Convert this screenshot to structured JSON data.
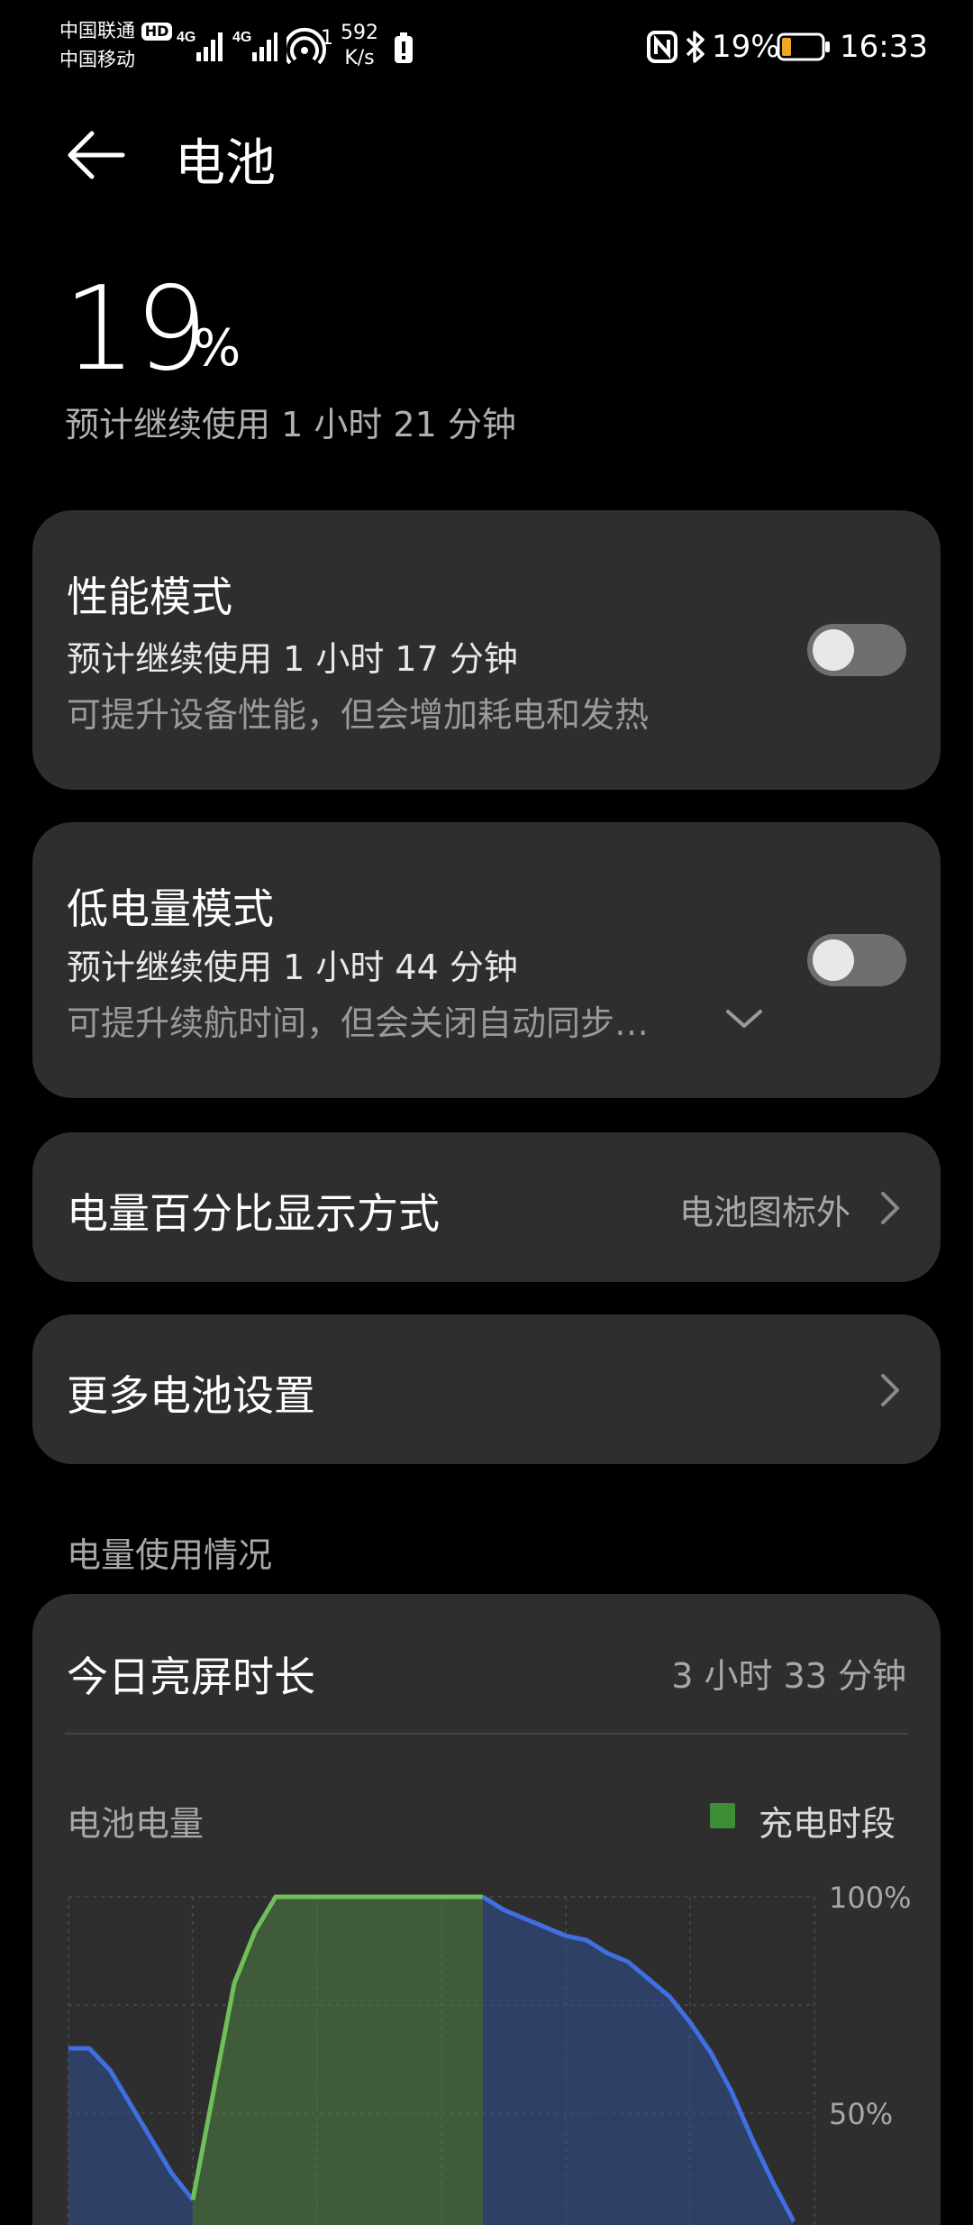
{
  "status_bar": {
    "carrier1": "中国联通",
    "hd_badge": "HD",
    "carrier2": "中国移动",
    "net1": "4G",
    "net2": "4G",
    "hotspot_count": "1",
    "speed_value": "592",
    "speed_unit": "K/s",
    "battery_pct": "19%",
    "time": "16:33",
    "icons": [
      "signal-icon",
      "hotspot-icon",
      "alert-icon",
      "nfc-icon",
      "bluetooth-icon",
      "battery-icon"
    ]
  },
  "header": {
    "title": "电池",
    "back_icon": "arrow-left-icon"
  },
  "hero": {
    "percent": "19",
    "percent_sign": "%",
    "estimate": "预计继续使用 1 小时 21 分钟"
  },
  "performance_mode": {
    "title": "性能模式",
    "estimate": "预计继续使用 1 小时 17 分钟",
    "desc": "可提升设备性能，但会增加耗电和发热",
    "enabled": false
  },
  "low_power_mode": {
    "title": "低电量模式",
    "estimate": "预计继续使用 1 小时 44 分钟",
    "desc": "可提升续航时间，但会关闭自动同步…",
    "enabled": false
  },
  "percent_display": {
    "label": "电量百分比显示方式",
    "value": "电池图标外"
  },
  "more_settings": {
    "label": "更多电池设置"
  },
  "usage": {
    "section_label": "电量使用情况",
    "screen_time_label": "今日亮屏时长",
    "screen_time_value": "3 小时 33 分钟",
    "battery_level_label": "电池电量",
    "legend_label": "充电时段"
  },
  "chart_data": {
    "type": "area",
    "ylabel_ticks": [
      "100%",
      "50%"
    ],
    "ylim": [
      0,
      100
    ],
    "colors": {
      "discharge": "#3f6fe0",
      "charge": "#6fbf5a",
      "legend": "#3e8e37"
    },
    "series": [
      {
        "name": "discharge",
        "x": [
          0,
          2,
          4,
          6,
          8,
          10,
          12
        ],
        "values": [
          65,
          65,
          60,
          52,
          44,
          36,
          30
        ]
      },
      {
        "name": "charge",
        "x": [
          12,
          14,
          16,
          18,
          20,
          22,
          40
        ],
        "values": [
          30,
          55,
          80,
          92,
          100,
          100,
          100
        ]
      },
      {
        "name": "discharge",
        "x": [
          40,
          42,
          44,
          46,
          48,
          50,
          52,
          54,
          56,
          58,
          60,
          62,
          64,
          66,
          68,
          70
        ],
        "values": [
          100,
          97,
          95,
          93,
          91,
          90,
          87,
          85,
          81,
          77,
          71,
          64,
          55,
          44,
          34,
          25
        ]
      }
    ],
    "xlim": [
      0,
      72
    ]
  }
}
